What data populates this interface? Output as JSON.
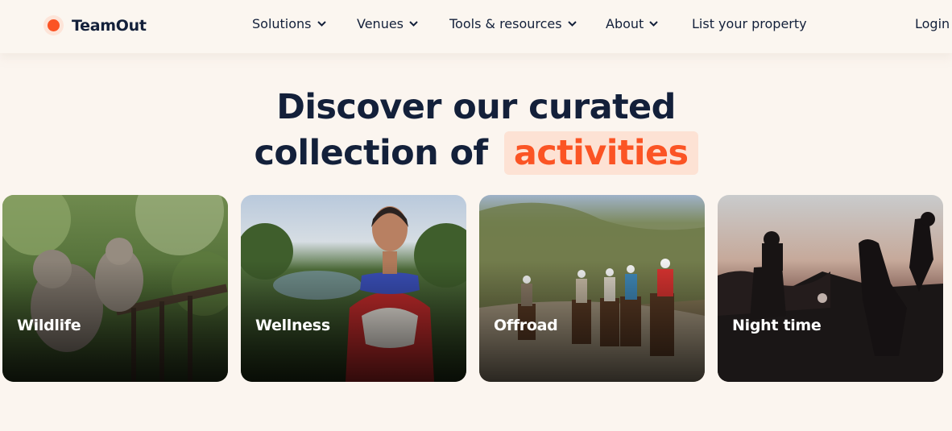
{
  "header": {
    "brand": "TeamOut",
    "nav": [
      {
        "label": "Solutions",
        "has_dropdown": true
      },
      {
        "label": "Venues",
        "has_dropdown": true
      },
      {
        "label": "Tools & resources",
        "has_dropdown": true
      },
      {
        "label": "About",
        "has_dropdown": true
      },
      {
        "label": "List your property",
        "has_dropdown": false
      }
    ],
    "login": "Login"
  },
  "hero": {
    "line1": "Discover our curated",
    "line2_prefix": "collection of",
    "line2_highlight": "activities"
  },
  "activities": [
    {
      "label": "Wildlife"
    },
    {
      "label": "Wellness"
    },
    {
      "label": "Offroad"
    },
    {
      "label": "Night time"
    }
  ],
  "colors": {
    "accent": "#fb5424",
    "accent_soft": "#fde2d4",
    "text": "#13203a",
    "background": "#fbf5ef"
  }
}
